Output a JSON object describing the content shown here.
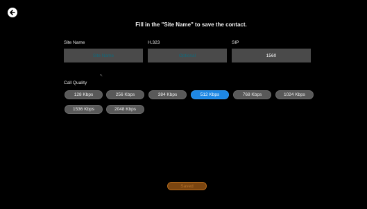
{
  "header": {
    "back_icon": "arrow-left-icon",
    "title": "Fill in the \"Site Name\" to save the contact."
  },
  "form": {
    "site_name": {
      "label": "Site Name",
      "value": "",
      "placeholder": "Site Name"
    },
    "h323": {
      "label": "H.323",
      "value": "",
      "placeholder": "Optional"
    },
    "sip": {
      "label": "SIP",
      "value": "1560"
    }
  },
  "call_quality": {
    "label": "Call Quality",
    "options": [
      "128 Kbps",
      "256 Kbps",
      "384 Kbps",
      "512 Kbps",
      "768 Kbps",
      "1024 Kbps",
      "1536 Kbps",
      "2048 Kbps"
    ],
    "selected": "512 Kbps"
  },
  "actions": {
    "save_label": "Saved"
  },
  "colors": {
    "background": "#000000",
    "selected": "#1e88e5",
    "save_button": "#7a4510",
    "field": "#4a4a4a"
  }
}
